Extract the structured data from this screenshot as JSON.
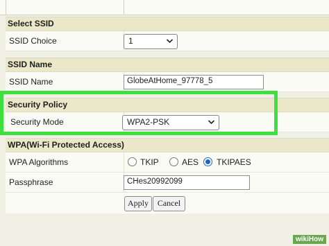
{
  "ssid_section": {
    "title": "Select SSID",
    "choice_label": "SSID Choice",
    "choice_value": "1"
  },
  "ssid_name_section": {
    "title": "SSID Name",
    "name_label": "SSID Name",
    "name_value": "GlobeAtHome_97778_5"
  },
  "security_section": {
    "title": "Security Policy",
    "mode_label": "Security Mode",
    "mode_value": "WPA2-PSK"
  },
  "wpa_section": {
    "title": "WPA(Wi-Fi Protected Access)",
    "alg_label": "WPA Algorithms",
    "alg_options": [
      "TKIP",
      "AES",
      "TKIPAES"
    ],
    "alg_selected": "TKIPAES",
    "pass_label": "Passphrase",
    "pass_value": "CHes20992099"
  },
  "buttons": {
    "apply": "Apply",
    "cancel": "Cancel"
  },
  "watermark": "wikiHow",
  "colors": {
    "highlight": "#3ee03e",
    "header_bg": "#ebe8c9",
    "radio_selected": "#1a64c8"
  }
}
